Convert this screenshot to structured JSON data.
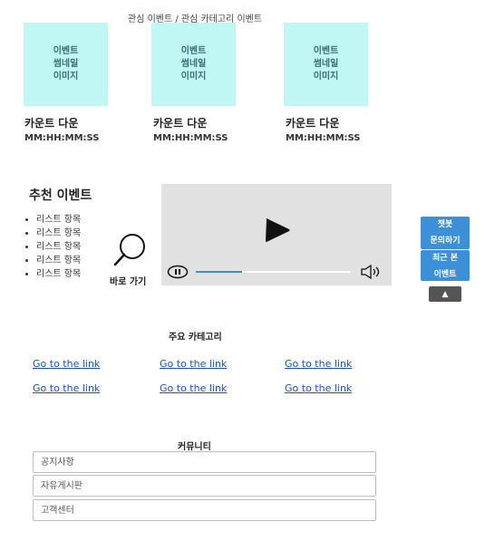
{
  "interest": {
    "title": "관심 이벤트 / 관심 카테고리 이벤트",
    "cards": [
      {
        "thumb_lines": [
          "이벤트",
          "썸네일",
          "이미지"
        ],
        "countdown_label": "카운트 다운",
        "time": "MM:HH:MM:SS"
      },
      {
        "thumb_lines": [
          "이벤트",
          "썸네일",
          "이미지"
        ],
        "countdown_label": "카운트 다운",
        "time": "MM:HH:MM:SS"
      },
      {
        "thumb_lines": [
          "이벤트",
          "썸네일",
          "이미지"
        ],
        "countdown_label": "카운트 다운",
        "time": "MM:HH:MM:SS"
      }
    ]
  },
  "recommended": {
    "title": "추천 이벤트",
    "items": [
      "리스트 항목",
      "리스트 항목",
      "리스트 항목",
      "리스트 항목",
      "리스트 항목"
    ],
    "search_label": "바로 가기"
  },
  "video": {
    "progress": 0.3
  },
  "side": {
    "chatbot_lines": [
      "챗봇",
      "문의하기"
    ],
    "recent_lines": [
      "최근 본",
      "이벤트"
    ],
    "top_glyph": "▲"
  },
  "categories": {
    "title": "주요 카테고리",
    "links": [
      [
        "Go to the link",
        "Go to the link",
        "Go to the link"
      ],
      [
        "Go to the link",
        "Go to the link",
        "Go to the link"
      ]
    ]
  },
  "community": {
    "title": "커뮤니티",
    "items": [
      "공지사항",
      "자유게시판",
      "고객센터"
    ]
  },
  "icons": {
    "search": "search-icon",
    "play": "play-icon",
    "pause": "pause-icon",
    "volume": "volume-icon",
    "arrow_up": "arrow-up-icon"
  }
}
